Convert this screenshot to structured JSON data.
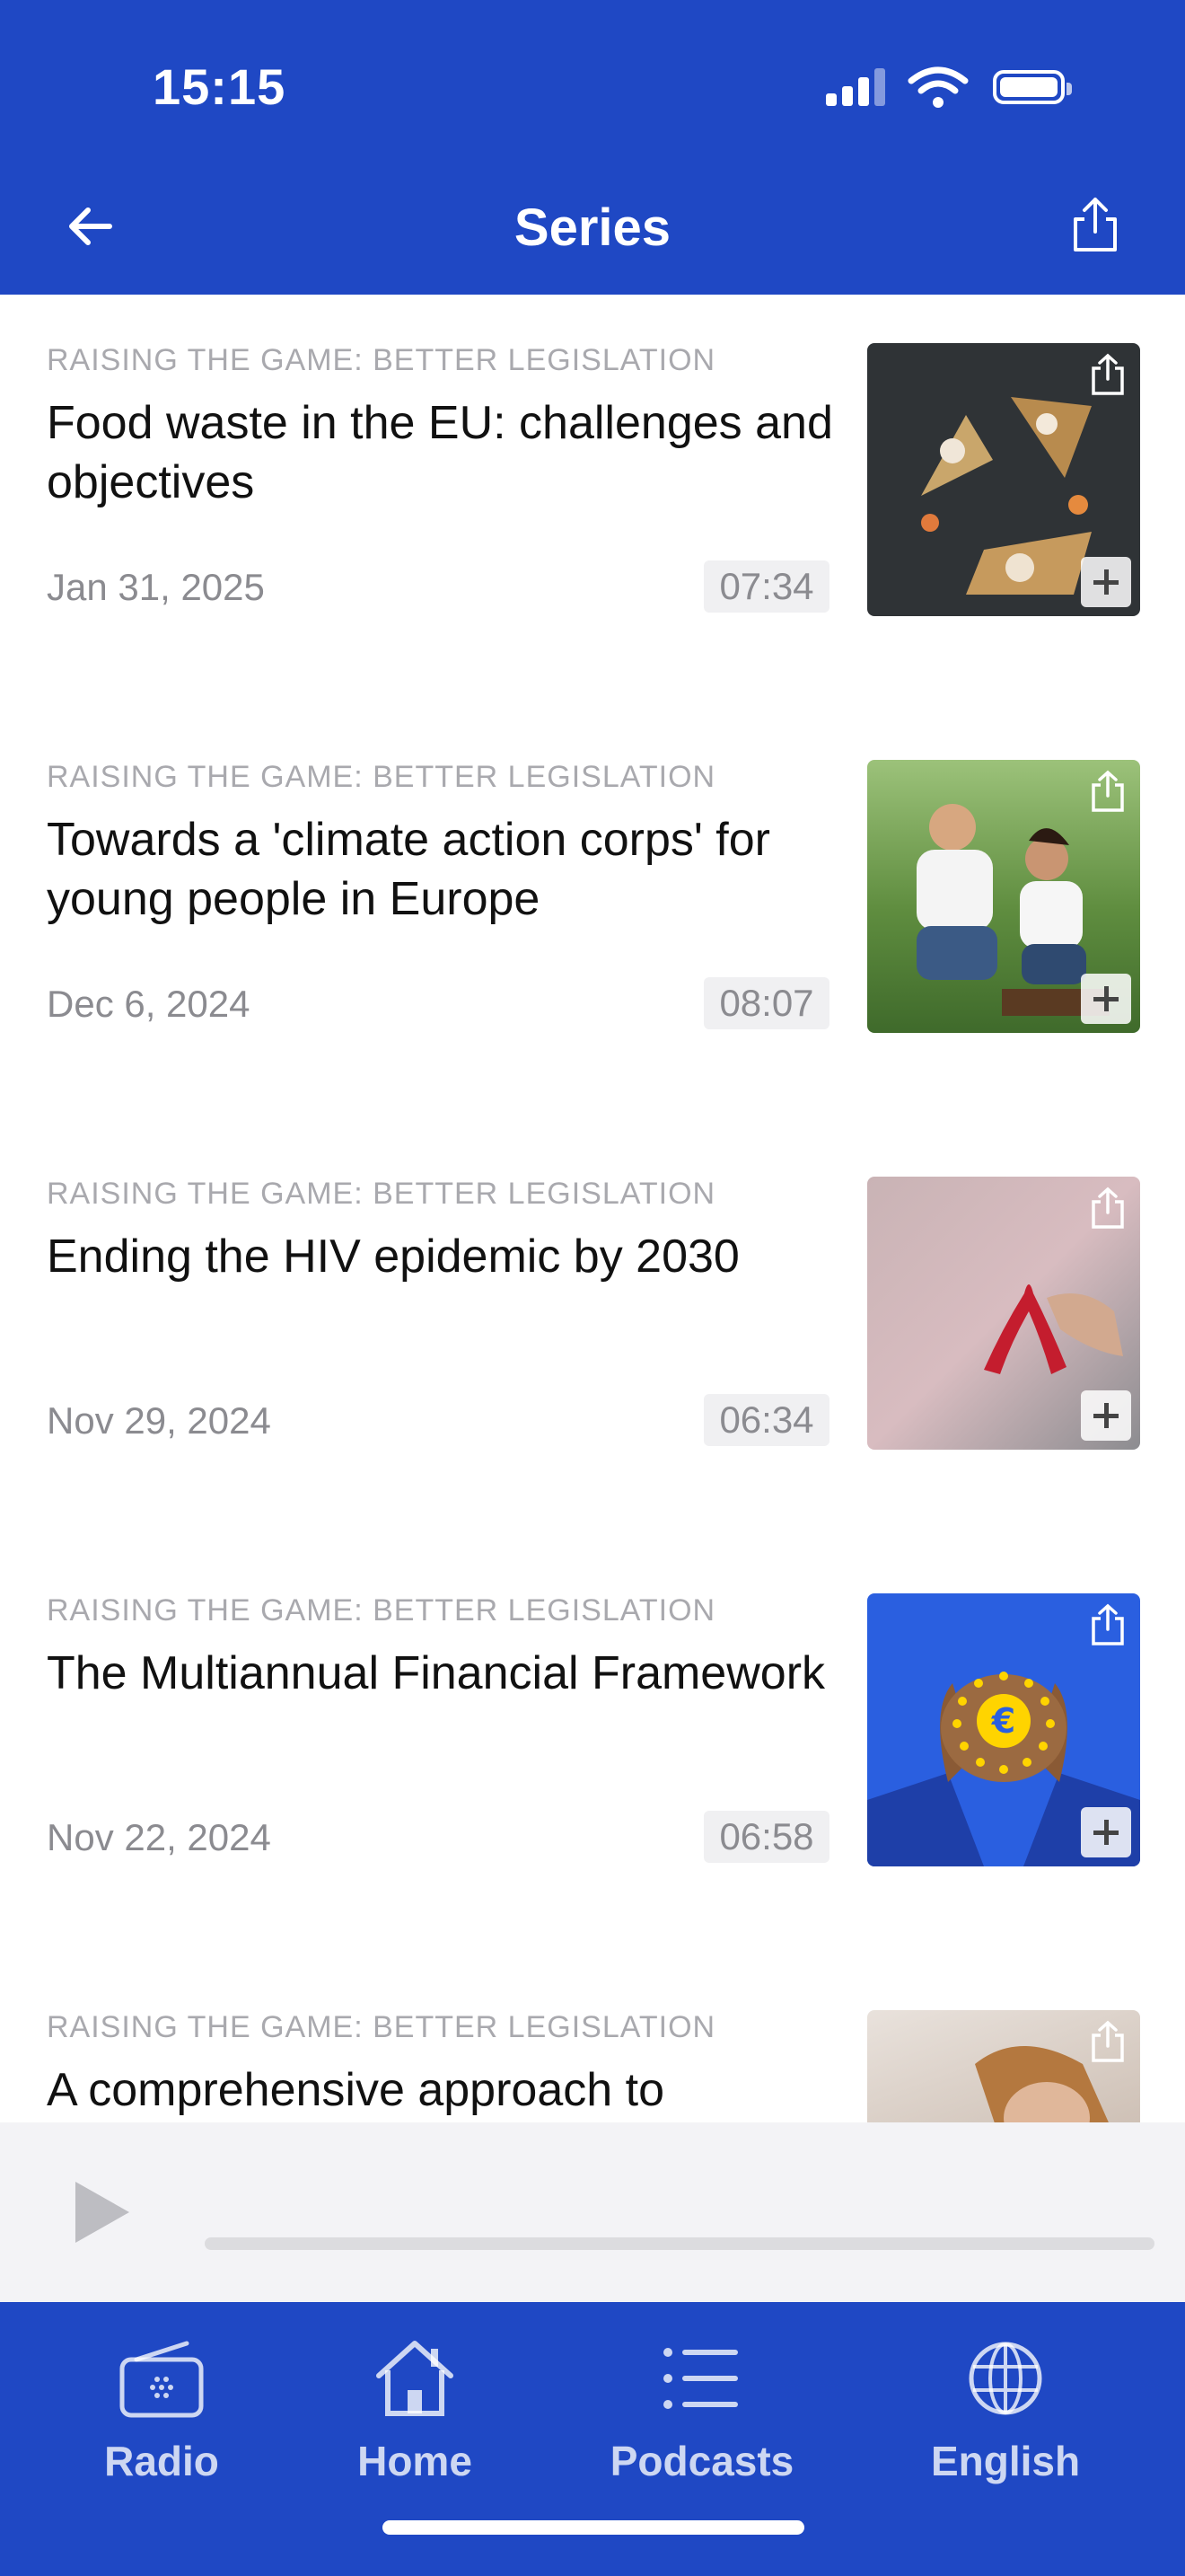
{
  "status_bar": {
    "time": "15:15"
  },
  "nav": {
    "title": "Series"
  },
  "episodes": [
    {
      "series": "RAISING THE GAME: BETTER LEGISLATION",
      "title": "Food waste in the EU: challenges and objectives",
      "date": "Jan 31, 2025",
      "duration": "07:34",
      "thumb_icon": "food-waste-recycle-image"
    },
    {
      "series": "RAISING THE GAME: BETTER LEGISLATION",
      "title": "Towards a 'climate action corps' for young people in Europe",
      "date": "Dec 6, 2024",
      "duration": "08:07",
      "thumb_icon": "volunteers-planting-image"
    },
    {
      "series": "RAISING THE GAME: BETTER LEGISLATION",
      "title": "Ending the HIV epidemic by 2030",
      "date": "Nov 29, 2024",
      "duration": "06:34",
      "thumb_icon": "red-ribbon-image"
    },
    {
      "series": "RAISING THE GAME: BETTER LEGISLATION",
      "title": "The Multiannual Financial Framework",
      "date": "Nov 22, 2024",
      "duration": "06:58",
      "thumb_icon": "euro-hands-image"
    },
    {
      "series": "RAISING THE GAME: BETTER LEGISLATION",
      "title": "A comprehensive approach to",
      "date": "",
      "duration": "",
      "thumb_icon": "woman-portrait-image"
    }
  ],
  "tabs": [
    {
      "label": "Radio",
      "icon": "radio-icon"
    },
    {
      "label": "Home",
      "icon": "home-icon"
    },
    {
      "label": "Podcasts",
      "icon": "list-icon"
    },
    {
      "label": "English",
      "icon": "globe-icon"
    }
  ],
  "colors": {
    "brand": "#1f48c4",
    "player_bg": "#f3f3f6",
    "muted_text": "#8b8b90"
  }
}
